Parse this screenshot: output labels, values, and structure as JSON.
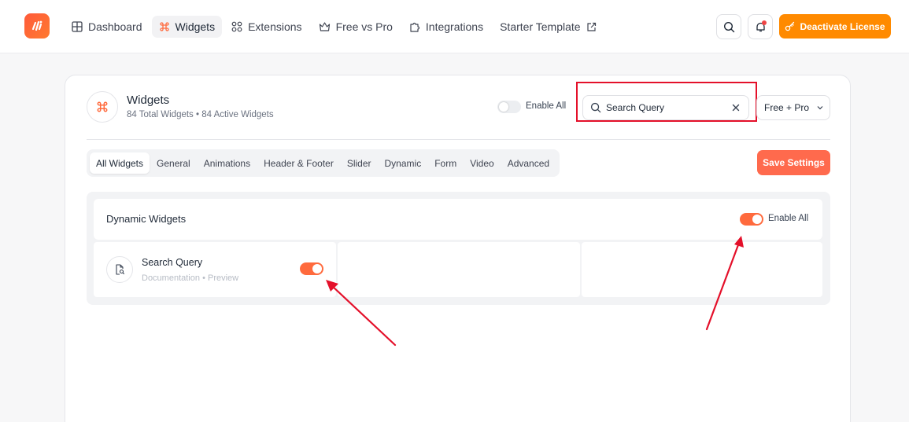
{
  "nav": {
    "items": [
      {
        "label": "Dashboard",
        "icon": "grid-icon"
      },
      {
        "label": "Widgets",
        "icon": "command-icon",
        "active": true
      },
      {
        "label": "Extensions",
        "icon": "extensions-icon"
      },
      {
        "label": "Free vs Pro",
        "icon": "crown-icon"
      },
      {
        "label": "Integrations",
        "icon": "puzzle-icon"
      },
      {
        "label": "Starter Template",
        "icon": "external-link-icon"
      }
    ],
    "deactivate_label": "Deactivate License"
  },
  "header": {
    "title": "Widgets",
    "subtitle": "84 Total Widgets • 84 Active Widgets",
    "enable_all_label": "Enable All",
    "enable_all_on": false,
    "search_value": "Search Query",
    "plan_selected": "Free + Pro"
  },
  "tabs": [
    "All Widgets",
    "General",
    "Animations",
    "Header & Footer",
    "Slider",
    "Dynamic",
    "Form",
    "Video",
    "Advanced"
  ],
  "save_label": "Save Settings",
  "section": {
    "title": "Dynamic Widgets",
    "enable_all_label": "Enable All",
    "enable_all_on": true,
    "widgets": [
      {
        "name": "Search Query",
        "doc_label": "Documentation",
        "separator": "•",
        "preview_label": "Preview",
        "enabled": true
      }
    ]
  },
  "colors": {
    "accent": "#ff6a3d",
    "deactivate": "#ff8a00",
    "annotation": "#e4102a"
  }
}
